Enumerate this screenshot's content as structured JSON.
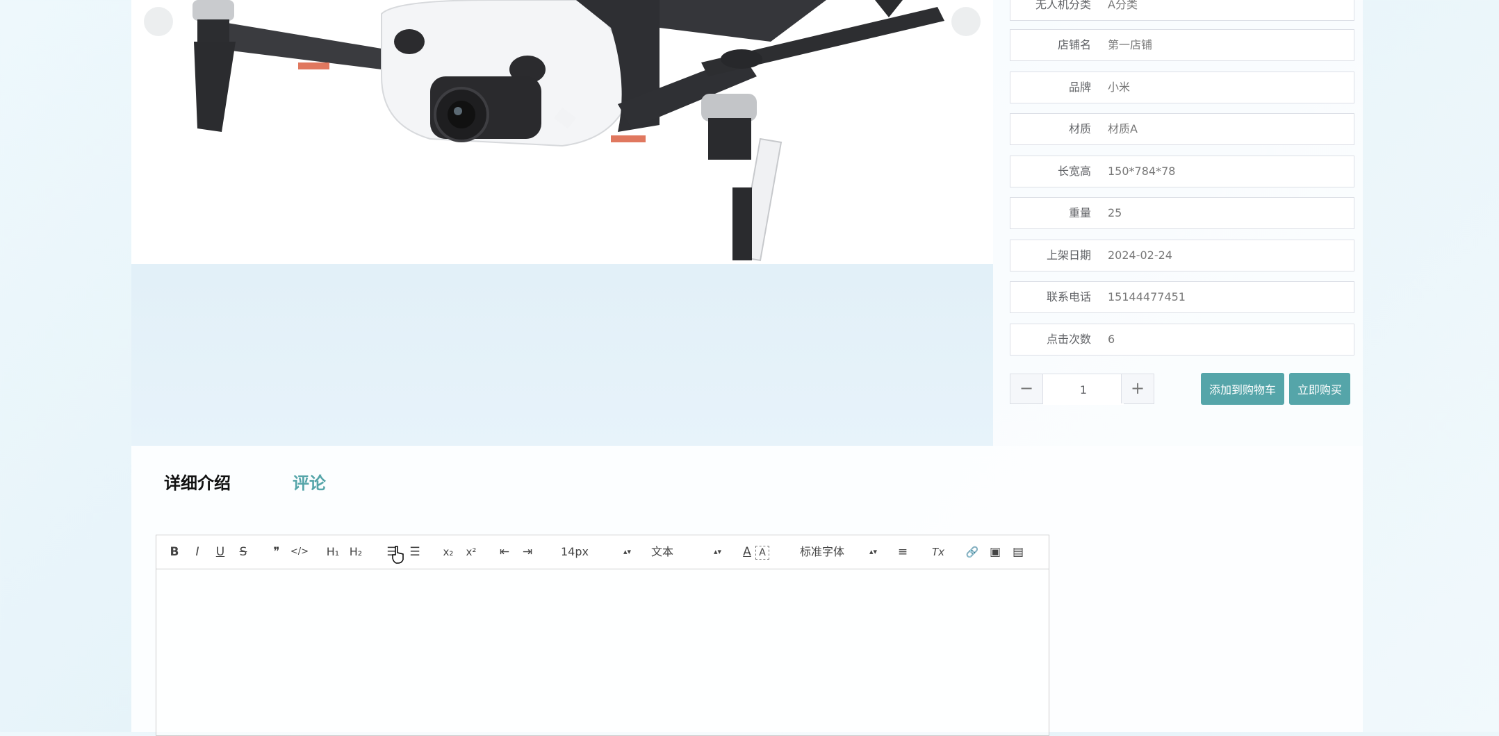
{
  "gallery": {
    "image_alt": "drone-product-photo"
  },
  "attributes": [
    {
      "label": "无人机分类",
      "value": "A分类"
    },
    {
      "label": "店铺名",
      "value": "第一店铺"
    },
    {
      "label": "品牌",
      "value": "小米"
    },
    {
      "label": "材质",
      "value": "材质A"
    },
    {
      "label": "长宽高",
      "value": "150*784*78"
    },
    {
      "label": "重量",
      "value": "25"
    },
    {
      "label": "上架日期",
      "value": "2024-02-24"
    },
    {
      "label": "联系电话",
      "value": "15144477451"
    },
    {
      "label": "点击次数",
      "value": "6"
    }
  ],
  "quantity": {
    "value": "1",
    "minus": "−",
    "plus": "+"
  },
  "actions": {
    "add_to_cart": "添加到购物车",
    "buy_now": "立即购买"
  },
  "tabs": {
    "detail": "详细介绍",
    "comments": "评论"
  },
  "editor": {
    "bold": "B",
    "italic": "I",
    "underline": "U",
    "strike": "S",
    "quote": "❞",
    "code": "</>",
    "h1": "H₁",
    "h2": "H₂",
    "ordered_list": "☰",
    "bullet_list": "☰",
    "subscript": "x₂",
    "superscript": "x²",
    "outdent": "⇤",
    "indent": "⇥",
    "font_size": "14px",
    "header_select": "文本",
    "font_family": "标准字体",
    "align": "≡",
    "clean": "Tx",
    "link": "🔗",
    "image": "▣",
    "video": "▤"
  },
  "colors": {
    "accent": "#55a5a9",
    "border": "#dcdfe6"
  }
}
